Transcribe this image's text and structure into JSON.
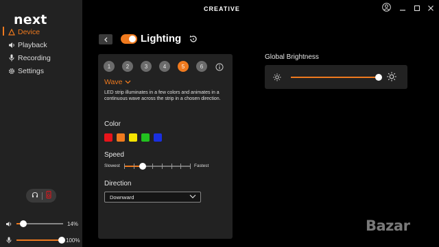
{
  "app": {
    "logo_text": "CREATIVE",
    "brand_text": "next"
  },
  "sidebar": {
    "items": [
      {
        "label": "Device",
        "icon": "warning-triangle-icon",
        "active": true
      },
      {
        "label": "Playback",
        "icon": "speaker-icon",
        "active": false
      },
      {
        "label": "Recording",
        "icon": "microphone-icon",
        "active": false
      },
      {
        "label": "Settings",
        "icon": "gear-icon",
        "active": false
      }
    ],
    "speaker_volume": {
      "value": 14,
      "label": "14%"
    },
    "mic_volume": {
      "value": 100,
      "label": "100%"
    }
  },
  "lighting": {
    "title": "Lighting",
    "enabled": true,
    "presets": [
      "1",
      "2",
      "3",
      "4",
      "5",
      "6"
    ],
    "active_preset": 4,
    "effect": "Wave",
    "description": "LED strip illuminates in a few colors and animates in a continuous wave across the strip in a chosen direction.",
    "color_label": "Color",
    "colors": [
      "#e8141a",
      "#f07a1e",
      "#f5e400",
      "#22c21f",
      "#1a2fe0"
    ],
    "speed_label": "Speed",
    "speed_min_label": "Slowest",
    "speed_max_label": "Fastest",
    "speed_value": 2,
    "speed_steps": 8,
    "direction_label": "Direction",
    "direction_value": "Downward"
  },
  "global_brightness": {
    "label": "Global Brightness",
    "value": 1.0
  },
  "watermark_text": "Bazar",
  "colors": {
    "accent": "#f07a1e",
    "sidebar_bg": "#222222",
    "panel_bg": "#222222"
  }
}
